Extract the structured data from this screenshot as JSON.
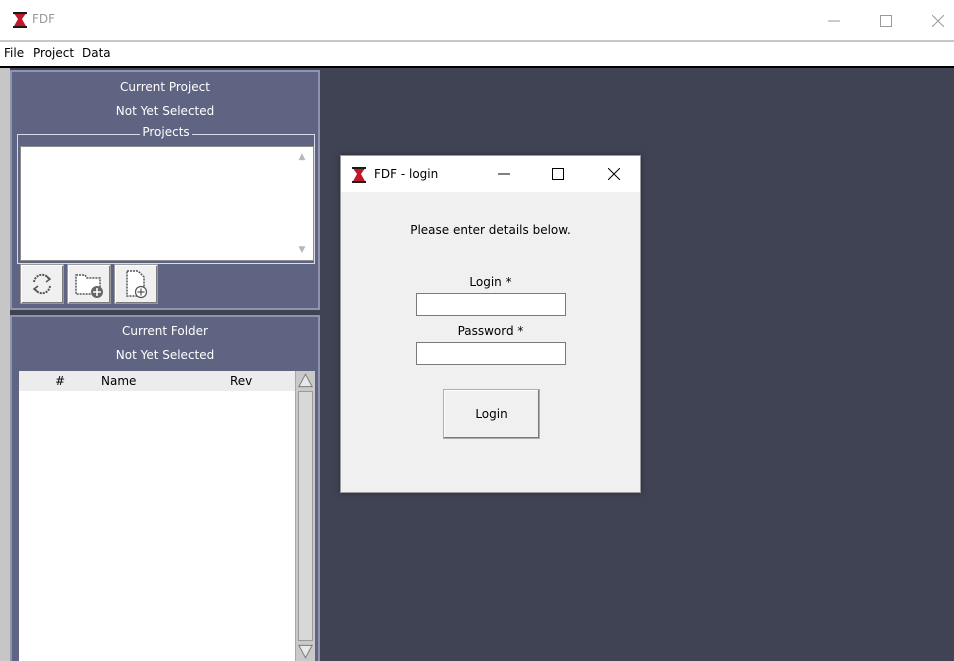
{
  "window": {
    "title": "FDF",
    "controls": [
      "minimize-icon",
      "maximize-icon",
      "close-icon"
    ]
  },
  "menu": {
    "items": [
      "File",
      "Project",
      "Data"
    ]
  },
  "project_panel": {
    "header_line1": "Current Project",
    "header_line2": "Not Yet Selected",
    "group_label": "Projects",
    "projects": [],
    "toolbar": {
      "buttons": [
        "refresh-icon",
        "folder-add-icon",
        "file-add-icon"
      ]
    }
  },
  "folder_panel": {
    "header_line1": "Current Folder",
    "header_line2": "Not Yet Selected",
    "columns": [
      "#",
      "Name",
      "Rev"
    ],
    "rows": []
  },
  "login_dialog": {
    "title": "FDF - login",
    "instruction": "Please enter details below.",
    "login_label": "Login *",
    "login_value": "",
    "password_label": "Password *",
    "password_value": "",
    "submit_label": "Login"
  },
  "colors": {
    "panel": "#5f6482",
    "workspace": "#404354",
    "icon_red": "#c0182a"
  }
}
